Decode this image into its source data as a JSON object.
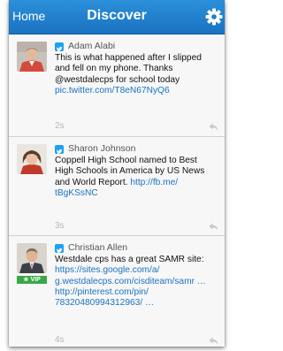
{
  "nav": {
    "home_label": "Home",
    "title": "Discover",
    "settings_icon": "gear-icon"
  },
  "tweets": [
    {
      "author": "Adam Alabi",
      "source_icon": "twitter-icon",
      "lines": [
        "This is what happened after I slipped",
        "and fell on my phone. Thanks",
        "@westdalecps for school today"
      ],
      "link": "pic.twitter.com/T8eN67NyQ6",
      "time": "2s"
    },
    {
      "author": "Sharon Johnson",
      "source_icon": "twitter-icon",
      "lines": [
        "Coppell High School named to Best",
        "High Schools in America by US News",
        "and World Report."
      ],
      "link_a": "http://fb.me/",
      "link_b": "tBgKSsNC",
      "time": "3s"
    },
    {
      "author": "Christian Allen",
      "source_icon": "twitter-icon",
      "badge": "VIP",
      "line1": "Westdale cps has a great SAMR site:",
      "links": [
        "https://sites.google.com/a/",
        "g.westdalecps.com/cisditeam/samr …",
        "http://pinterest.com/pin/",
        "78320480994312963/ …"
      ],
      "time": "4s"
    }
  ],
  "colors": {
    "nav_bar": "#1a73c2",
    "link": "#1a73c2",
    "vip_badge": "#3aa84a"
  }
}
